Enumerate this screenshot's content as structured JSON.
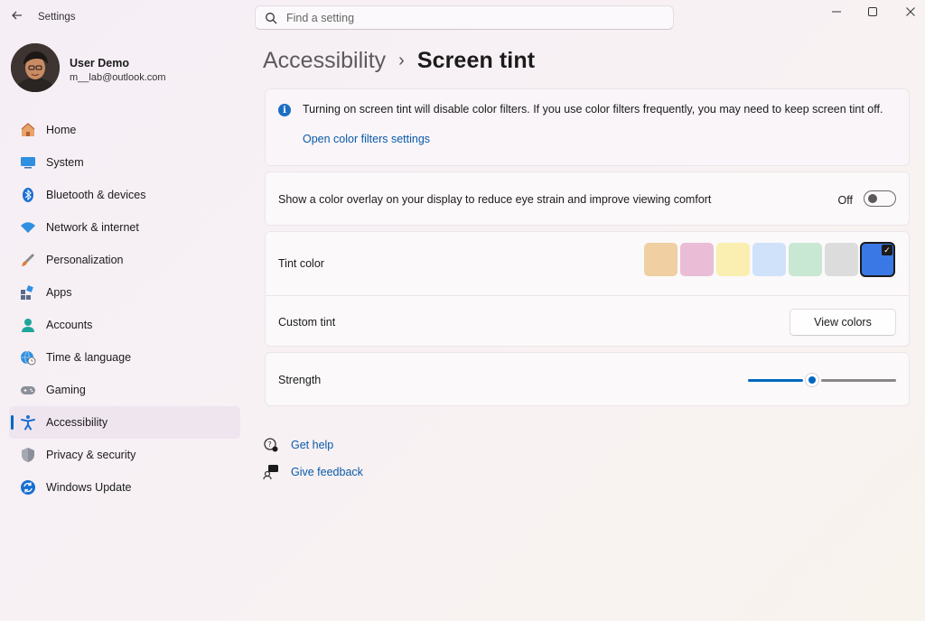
{
  "app": {
    "title": "Settings"
  },
  "search": {
    "placeholder": "Find a setting"
  },
  "profile": {
    "name": "User Demo",
    "email": "m__lab@outlook.com"
  },
  "sidebar": {
    "items": [
      {
        "label": "Home",
        "icon": "home-icon"
      },
      {
        "label": "System",
        "icon": "system-icon"
      },
      {
        "label": "Bluetooth & devices",
        "icon": "bluetooth-icon"
      },
      {
        "label": "Network & internet",
        "icon": "wifi-icon"
      },
      {
        "label": "Personalization",
        "icon": "brush-icon"
      },
      {
        "label": "Apps",
        "icon": "apps-icon"
      },
      {
        "label": "Accounts",
        "icon": "accounts-icon"
      },
      {
        "label": "Time & language",
        "icon": "globe-clock-icon"
      },
      {
        "label": "Gaming",
        "icon": "gamepad-icon"
      },
      {
        "label": "Accessibility",
        "icon": "accessibility-icon",
        "active": true
      },
      {
        "label": "Privacy & security",
        "icon": "shield-icon"
      },
      {
        "label": "Windows Update",
        "icon": "update-icon"
      }
    ]
  },
  "breadcrumb": {
    "parent": "Accessibility",
    "current": "Screen tint"
  },
  "info": {
    "text": "Turning on screen tint will disable color filters. If you use color filters frequently, you may need to keep screen tint off.",
    "link": "Open color filters settings"
  },
  "overlay": {
    "label": "Show a color overlay on your display to reduce eye strain and improve viewing comfort",
    "state": "Off"
  },
  "tint": {
    "label": "Tint color",
    "swatches": [
      "#f0cfa3",
      "#ebbcd5",
      "#faefb0",
      "#cfe2fa",
      "#c8e8d3",
      "#dcdcdc",
      "#3a78e6"
    ],
    "selected_index": 6
  },
  "custom_tint": {
    "label": "Custom tint",
    "button": "View colors"
  },
  "strength": {
    "label": "Strength",
    "value": 0.43
  },
  "help": {
    "get_help": "Get help",
    "feedback": "Give feedback"
  },
  "colors": {
    "accent": "#0067c0",
    "link": "#0a5aa8"
  }
}
